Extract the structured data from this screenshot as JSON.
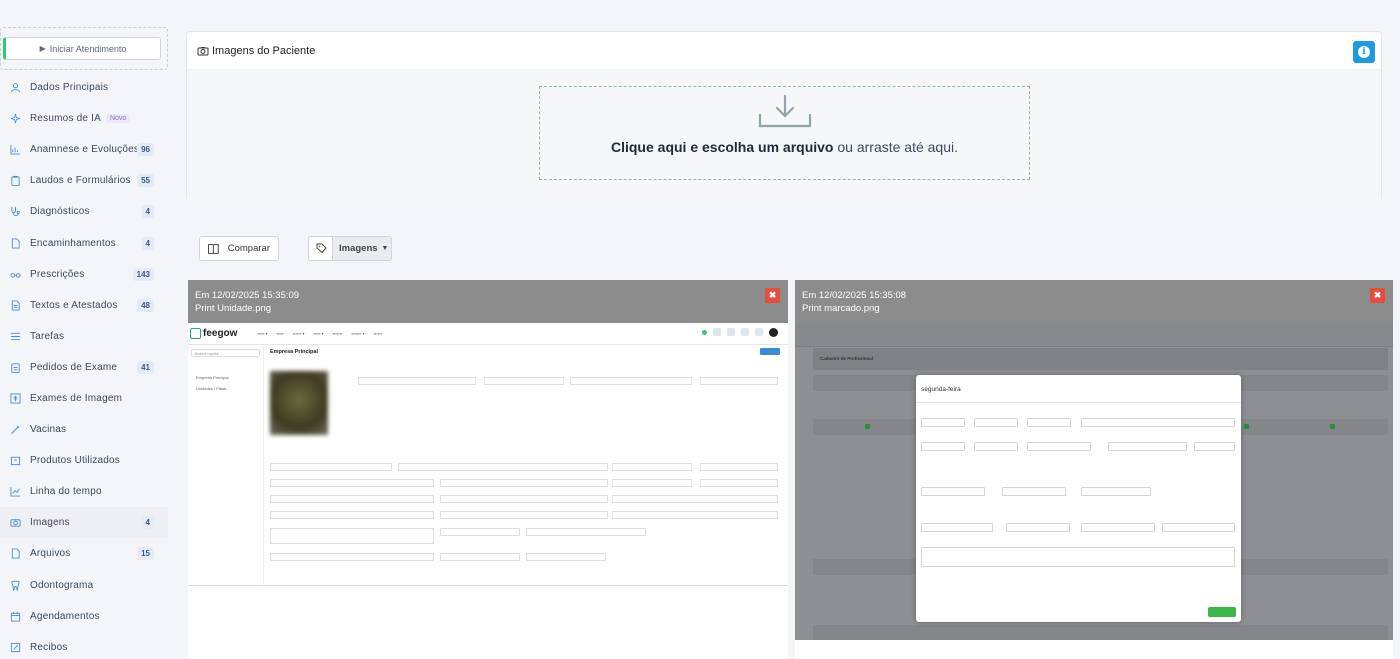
{
  "sidebar": {
    "start_button": "Iniciar Atendimento",
    "items": [
      {
        "label": "Dados Principais",
        "icon": "user-icon",
        "badge": ""
      },
      {
        "label": "Resumos de IA",
        "icon": "sparkle-icon",
        "badge": "",
        "tag": "Novo"
      },
      {
        "label": "Anamnese e Evoluções",
        "icon": "chart-icon",
        "badge": "96"
      },
      {
        "label": "Laudos e Formulários",
        "icon": "clipboard-icon",
        "badge": "55"
      },
      {
        "label": "Diagnósticos",
        "icon": "stethoscope-icon",
        "badge": "4"
      },
      {
        "label": "Encaminhamentos",
        "icon": "document-icon",
        "badge": "4"
      },
      {
        "label": "Prescrições",
        "icon": "glasses-icon",
        "badge": "143"
      },
      {
        "label": "Textos e Atestados",
        "icon": "file-text-icon",
        "badge": "48"
      },
      {
        "label": "Tarefas",
        "icon": "list-icon",
        "badge": ""
      },
      {
        "label": "Pedidos de Exame",
        "icon": "clipboard-list-icon",
        "badge": "41"
      },
      {
        "label": "Exames de Imagem",
        "icon": "xray-icon",
        "badge": ""
      },
      {
        "label": "Vacinas",
        "icon": "syringe-icon",
        "badge": ""
      },
      {
        "label": "Produtos Utilizados",
        "icon": "box-icon",
        "badge": ""
      },
      {
        "label": "Linha do tempo",
        "icon": "timeline-icon",
        "badge": ""
      },
      {
        "label": "Imagens",
        "icon": "camera-icon",
        "badge": "4",
        "active": true
      },
      {
        "label": "Arquivos",
        "icon": "file-icon",
        "badge": "15"
      },
      {
        "label": "Odontograma",
        "icon": "tooth-icon",
        "badge": ""
      },
      {
        "label": "Agendamentos",
        "icon": "calendar-icon",
        "badge": ""
      },
      {
        "label": "Recibos",
        "icon": "receipt-icon",
        "badge": ""
      }
    ]
  },
  "panel": {
    "title": "Imagens do Paciente",
    "drop_strong": "Clique aqui e escolha um arquivo",
    "drop_rest": " ou arraste até aqui."
  },
  "toolbar": {
    "compare_label": "Comparar",
    "images_label": "Imagens"
  },
  "cards": [
    {
      "date": "Em 12/02/2025 15:35:09",
      "filename": "Print Unidade.png"
    },
    {
      "date": "Em 12/02/2025 15:35:08",
      "filename": "Print marcado.png"
    }
  ],
  "shot1": {
    "logo": "feegow",
    "search": "Busca rápida...",
    "title": "Empresa Principal",
    "side": [
      "Empresa Principal",
      "Unidades / Filiais"
    ]
  },
  "shot2": {
    "modal_title": "segunda-feira",
    "header": "Cadastro de Profissional"
  },
  "colors": {
    "accent": "#1e9be0",
    "start_green": "#2ecc71",
    "close_red": "#e74c3c",
    "card_header": "#8c8c8c"
  }
}
